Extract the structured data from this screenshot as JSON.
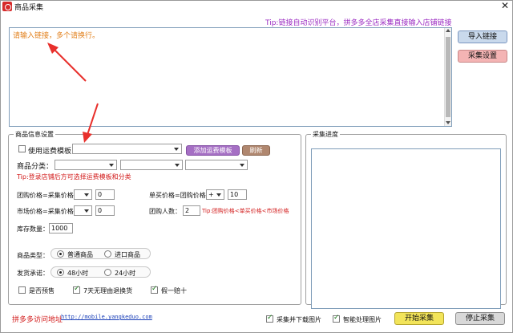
{
  "window": {
    "title": "商品采集",
    "close": "✕"
  },
  "url_input": {
    "placeholder": "请输入链接，多个请换行。"
  },
  "tip_top": "Tip:链接自动识别平台，拼多多全店采集直接输入店铺链接",
  "side_buttons": {
    "import": "导入链接",
    "settings": "采集设置"
  },
  "info_group": {
    "legend": "商品信息设置",
    "use_template": "使用运费模板",
    "add_template": "添加运费模板",
    "refresh": "刷新",
    "category_label": "商品分类：",
    "tip_login": "Tip:登录店铺后方可选择运费模板和分类",
    "group_price_label": "团购价格=采集价格",
    "group_price_value": "0",
    "single_price_label": "单买价格=团购价格",
    "single_price_op": "+",
    "single_price_value": "10",
    "market_price_label": "市场价格=采集价格",
    "market_price_value": "0",
    "group_people_label": "团购人数：",
    "group_people_value": "2",
    "tip_price": "Tip:团购价格<单买价格<市场价格",
    "stock_label": "库存数量：",
    "stock_value": "1000",
    "goods_type_label": "商品类型：",
    "goods_type_opt1": "普通商品",
    "goods_type_opt2": "进口商品",
    "ship_label": "发货承诺：",
    "ship_opt1": "48小时",
    "ship_opt2": "24小时",
    "presale": "是否预售",
    "seven_day": "7天无理由退换货",
    "fake_ten": "假一赔十"
  },
  "progress_group": {
    "legend": "采集进度"
  },
  "footer": {
    "link_label": "拼多多访问地址",
    "link_url": "http://mobile.yangkeduo.com",
    "download_images": "采集并下载图片",
    "smart_images": "智能处理图片",
    "start": "开始采集",
    "stop": "停止采集"
  },
  "colors": {
    "arrow": "#e8302c",
    "tip_purple": "#9b2bc2",
    "tip_red": "#d21a1a",
    "placeholder_orange": "#e2801c"
  }
}
